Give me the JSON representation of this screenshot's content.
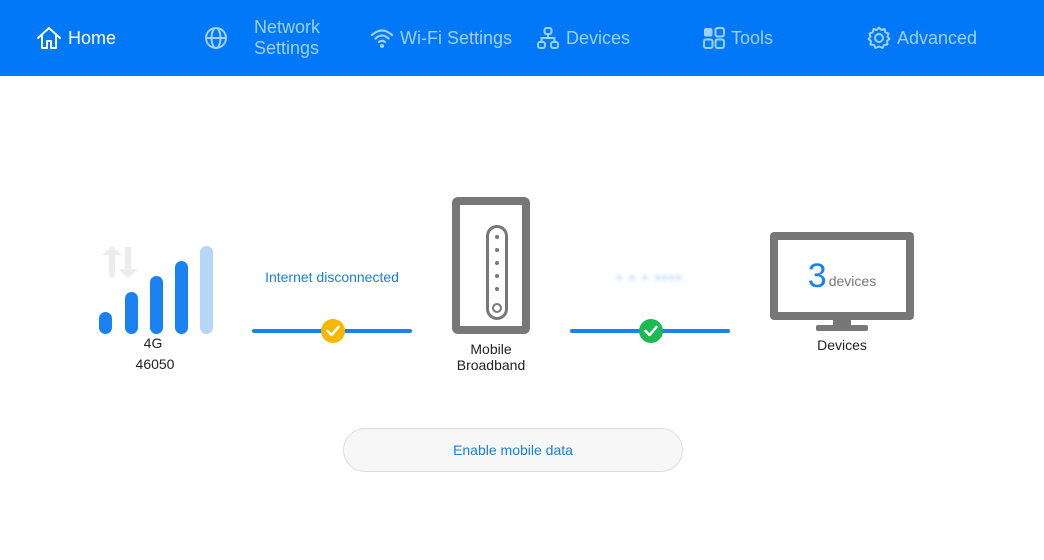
{
  "nav": {
    "items": [
      {
        "label": "Home",
        "icon": "home-icon",
        "active": true
      },
      {
        "label": "Network Settings",
        "label_line1": "Network",
        "label_line2": "Settings",
        "icon": "globe-icon"
      },
      {
        "label": "Wi-Fi Settings",
        "icon": "wifi-icon"
      },
      {
        "label": "Devices",
        "icon": "network-tree-icon"
      },
      {
        "label": "Tools",
        "icon": "grid-icon"
      },
      {
        "label": "Advanced",
        "icon": "gear-icon"
      }
    ]
  },
  "signal": {
    "bars_total": 5,
    "bars_active": 4,
    "network_type": "4G",
    "operator_code": "46050",
    "data_icon": "up-down-arrows-icon"
  },
  "internet_link": {
    "status_text": "Internet disconnected",
    "status_color": "#f5b800"
  },
  "router": {
    "label_line1": "Mobile",
    "label_line2": "Broadband"
  },
  "wifi_link": {
    "status_text": "Wi-Fi name (obscured)",
    "status_color": "#1db954"
  },
  "devices": {
    "count": "3",
    "unit": "devices",
    "label": "Devices"
  },
  "actions": {
    "enable_mobile_data": "Enable mobile data"
  },
  "colors": {
    "brand": "#0078f8",
    "accent": "#1a82f0",
    "device_gray": "#777777"
  }
}
